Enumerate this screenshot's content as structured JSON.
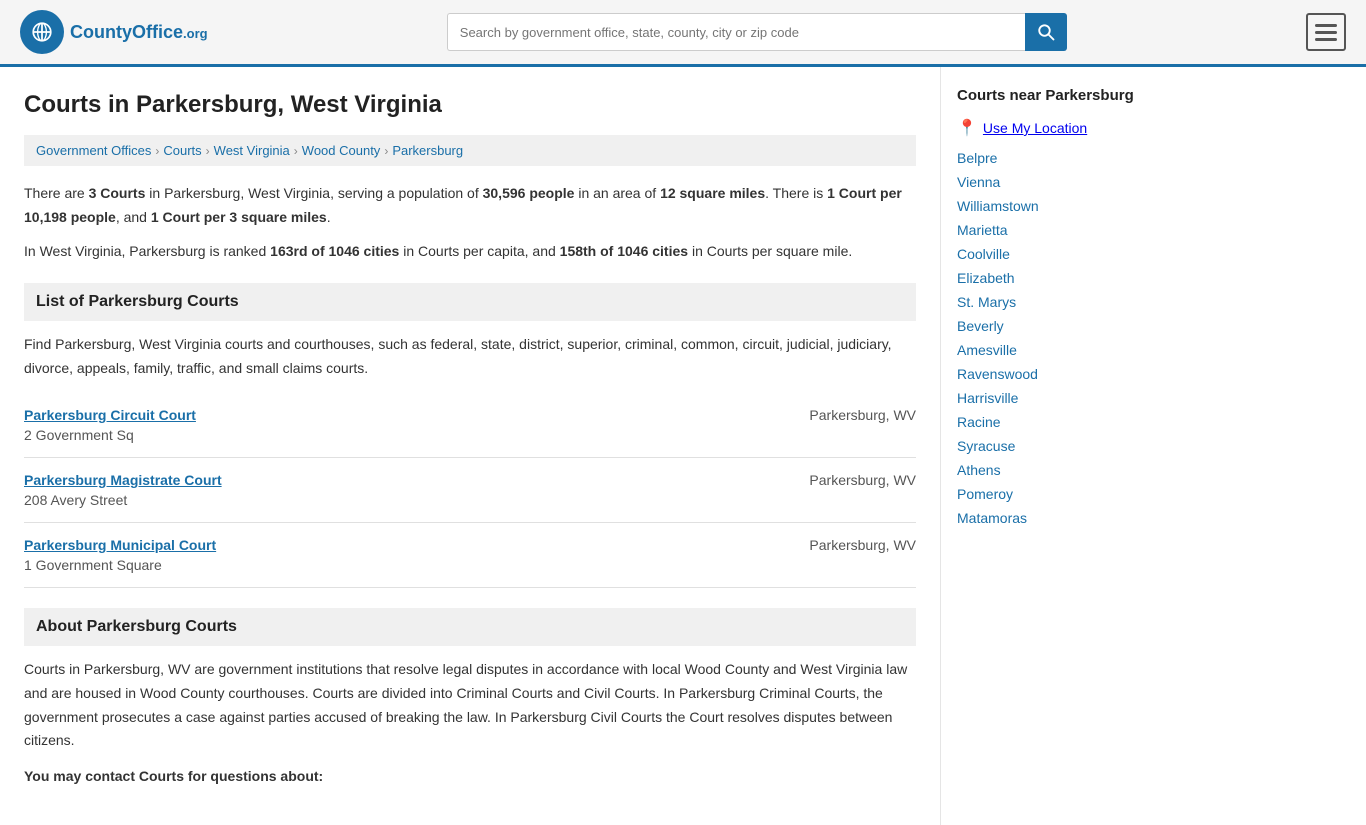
{
  "header": {
    "logo_text": "CountyOffice",
    "logo_org": ".org",
    "search_placeholder": "Search by government office, state, county, city or zip code"
  },
  "breadcrumb": {
    "items": [
      {
        "label": "Government Offices",
        "href": "#"
      },
      {
        "label": "Courts",
        "href": "#"
      },
      {
        "label": "West Virginia",
        "href": "#"
      },
      {
        "label": "Wood County",
        "href": "#"
      },
      {
        "label": "Parkersburg",
        "href": "#"
      }
    ]
  },
  "page": {
    "title": "Courts in Parkersburg, West Virginia",
    "stats_1": "There are ",
    "stats_count": "3 Courts",
    "stats_2": " in Parkersburg, West Virginia, serving a population of ",
    "stats_population": "30,596 people",
    "stats_3": " in an area of ",
    "stats_area": "12 square miles",
    "stats_4": ". There is ",
    "stats_per_person": "1 Court per 10,198 people",
    "stats_5": ", and ",
    "stats_per_mile": "1 Court per 3 square miles",
    "stats_6": ".",
    "rank_text_1": "In West Virginia, Parkersburg is ranked ",
    "rank_capita": "163rd of 1046 cities",
    "rank_text_2": " in Courts per capita, and ",
    "rank_sqmile": "158th of 1046 cities",
    "rank_text_3": " in Courts per square mile.",
    "list_header": "List of Parkersburg Courts",
    "list_desc": "Find Parkersburg, West Virginia courts and courthouses, such as federal, state, district, superior, criminal, common, circuit, judicial, judiciary, divorce, appeals, family, traffic, and small claims courts.",
    "courts": [
      {
        "name": "Parkersburg Circuit Court",
        "address": "2 Government Sq",
        "city_state": "Parkersburg, WV"
      },
      {
        "name": "Parkersburg Magistrate Court",
        "address": "208 Avery Street",
        "city_state": "Parkersburg, WV"
      },
      {
        "name": "Parkersburg Municipal Court",
        "address": "1 Government Square",
        "city_state": "Parkersburg, WV"
      }
    ],
    "about_header": "About Parkersburg Courts",
    "about_text": "Courts in Parkersburg, WV are government institutions that resolve legal disputes in accordance with local Wood County and West Virginia law and are housed in Wood County courthouses. Courts are divided into Criminal Courts and Civil Courts. In Parkersburg Criminal Courts, the government prosecutes a case against parties accused of breaking the law. In Parkersburg Civil Courts the Court resolves disputes between citizens.",
    "contact_header": "You may contact Courts for questions about:"
  },
  "sidebar": {
    "title": "Courts near Parkersburg",
    "use_location": "Use My Location",
    "nearby": [
      "Belpre",
      "Vienna",
      "Williamstown",
      "Marietta",
      "Coolville",
      "Elizabeth",
      "St. Marys",
      "Beverly",
      "Amesville",
      "Ravenswood",
      "Harrisville",
      "Racine",
      "Syracuse",
      "Athens",
      "Pomeroy",
      "Matamoras"
    ]
  }
}
